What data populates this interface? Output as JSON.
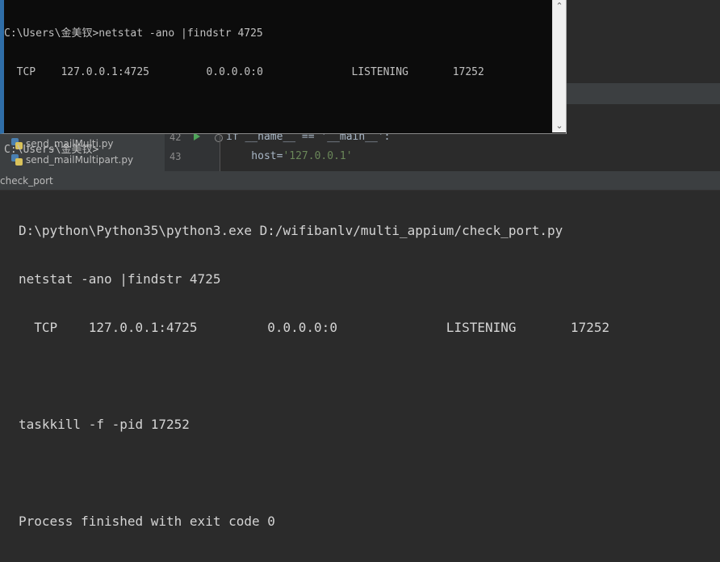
{
  "cmd": {
    "lines": [
      "C:\\Users\\金美钗>netstat -ano |findstr 4725",
      "  TCP    127.0.0.1:4725         0.0.0.0:0              LISTENING       17252",
      "",
      "C:\\Users\\金美钗>"
    ],
    "scroll_up_icon": "chevron-up-icon",
    "scroll_down_icon": "chevron-down-icon"
  },
  "project": {
    "items": [
      {
        "label": "send_mailMulti.py",
        "icon": "python-file-icon"
      },
      {
        "label": "send_mailMultipart.py",
        "icon": "python-file-icon"
      }
    ]
  },
  "editor": {
    "lines": [
      {
        "number": "42",
        "code": "if __name__ == '__main__':"
      },
      {
        "number": "43",
        "code": "host='127.0.0.1'"
      }
    ],
    "line43_prefix": "    host=",
    "line43_string": "'127.0.0.1'"
  },
  "run": {
    "tab_label": "check_port",
    "output": [
      "D:\\python\\Python35\\python3.exe D:/wifibanlv/multi_appium/check_port.py",
      "netstat -ano |findstr 4725",
      "  TCP    127.0.0.1:4725         0.0.0.0:0              LISTENING       17252",
      "",
      "taskkill -f -pid 17252",
      "",
      "Process finished with exit code 0"
    ]
  },
  "colors": {
    "ide_bg": "#2b2b2b",
    "panel_bg": "#3c3f41",
    "cmd_bg": "#0c0c0c",
    "cmd_text": "#c0c0c0",
    "string_green": "#6a8759",
    "run_arrow_green": "#4fa55a"
  }
}
